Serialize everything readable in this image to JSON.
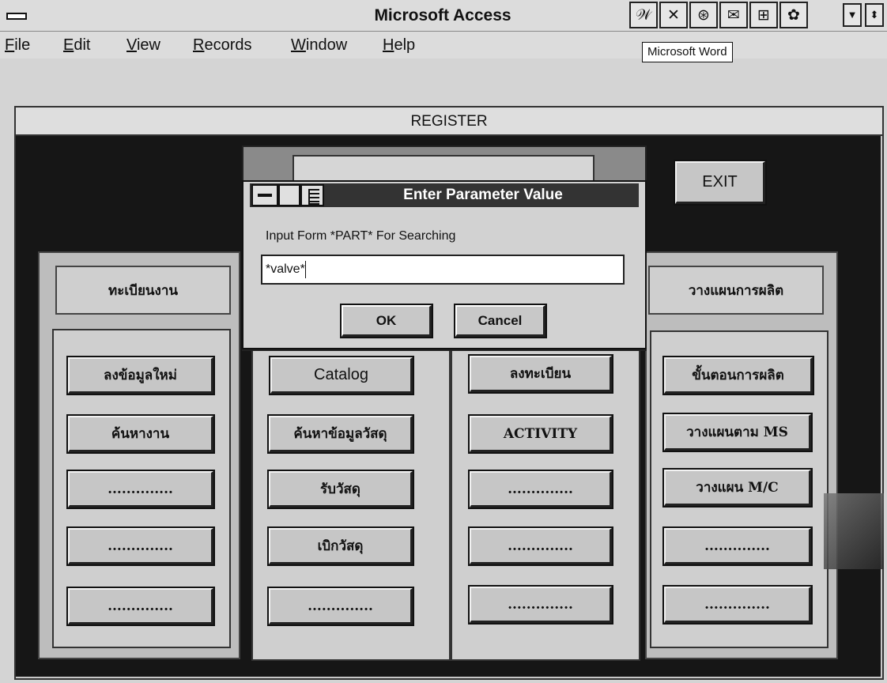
{
  "app": {
    "title": "Microsoft Access",
    "tooltip": "Microsoft Word",
    "toolbar_icons": [
      {
        "name": "word-icon",
        "glyph": "𝒲"
      },
      {
        "name": "excel-icon",
        "glyph": "✕"
      },
      {
        "name": "powerpoint-icon",
        "glyph": "⊛"
      },
      {
        "name": "mail-icon",
        "glyph": "✉"
      },
      {
        "name": "project-icon",
        "glyph": "⊞"
      },
      {
        "name": "schedule-icon",
        "glyph": "✿"
      }
    ],
    "window_controls": {
      "minimize": "▼",
      "restore": "⬍"
    }
  },
  "menubar": [
    {
      "label": "File",
      "underline": "F",
      "rest": "ile"
    },
    {
      "label": "Edit",
      "underline": "E",
      "rest": "dit"
    },
    {
      "label": "View",
      "underline": "V",
      "rest": "iew"
    },
    {
      "label": "Records",
      "underline": "R",
      "rest": "ecords"
    },
    {
      "label": "Window",
      "underline": "W",
      "rest": "indow"
    },
    {
      "label": "Help",
      "underline": "H",
      "rest": "elp"
    }
  ],
  "register": {
    "title": "REGISTER",
    "exit_label": "EXIT",
    "col1": {
      "header": "ทะเบียนงาน",
      "buttons": [
        "ลงข้อมูลใหม่",
        "ค้นหางาน",
        "..............",
        "..............",
        ".............."
      ]
    },
    "col2": {
      "buttons": [
        "Catalog",
        "ค้นหาข้อมูลวัสดุ",
        "รับวัสดุ",
        "เบิกวัสดุ",
        ".............."
      ]
    },
    "col3": {
      "buttons": [
        "ลงทะเบียน",
        "ACTIVITY",
        "..............",
        "..............",
        ".............."
      ]
    },
    "col4": {
      "header": "วางแผนการผลิต",
      "buttons": [
        "ขั้นตอนการผลิต",
        "วางแผนตาม MS",
        "วางแผน M/C",
        "..............",
        ".............."
      ]
    }
  },
  "dialog": {
    "title": "Enter Parameter Value",
    "prompt": "Input Form *PART* For Searching",
    "value": "*valve*",
    "ok_label": "OK",
    "cancel_label": "Cancel"
  }
}
